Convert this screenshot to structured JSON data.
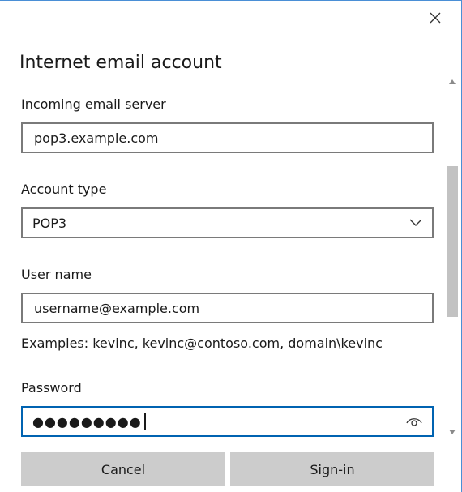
{
  "dialog": {
    "title": "Internet email account",
    "close_icon": "close-icon"
  },
  "fields": {
    "incoming_server": {
      "label": "Incoming email server",
      "value": "pop3.example.com"
    },
    "account_type": {
      "label": "Account type",
      "selected": "POP3",
      "icon": "chevron-down-icon"
    },
    "user_name": {
      "label": "User name",
      "value": "username@example.com",
      "hint": "Examples: kevinc, kevinc@contoso.com, domain\\kevinc"
    },
    "password": {
      "label": "Password",
      "masked_value": "●●●●●●●●●",
      "icon": "eye-icon"
    }
  },
  "buttons": {
    "cancel": "Cancel",
    "sign_in": "Sign-in"
  },
  "colors": {
    "focus_border": "#0063b1",
    "window_border": "#4a8fd6",
    "button_bg": "#cccccc",
    "field_border": "#7a7a7a"
  }
}
